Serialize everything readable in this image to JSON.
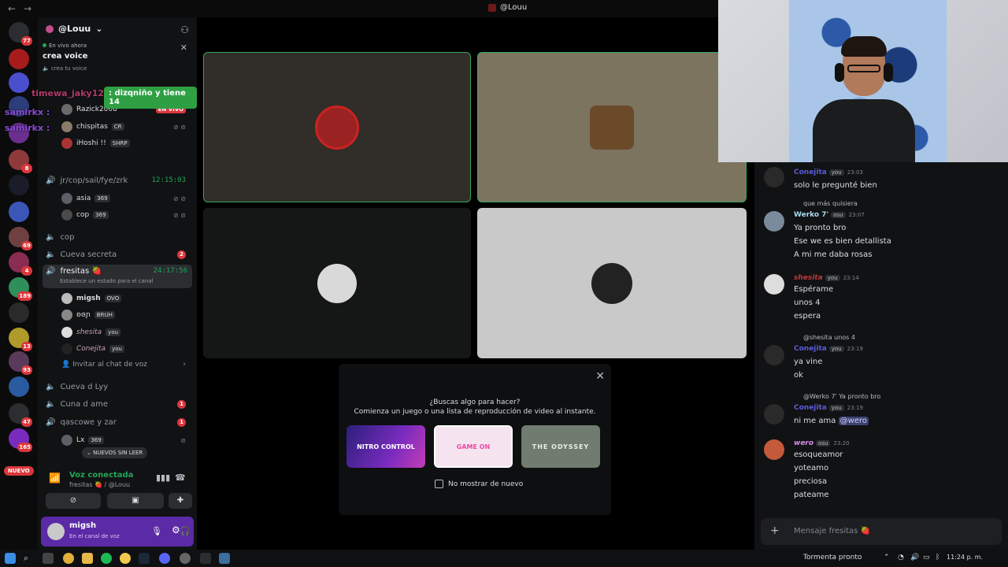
{
  "window": {
    "title": "@Louu",
    "back_label": "←",
    "forward_label": "→"
  },
  "guilds": {
    "badges": [
      "77",
      "8",
      "69",
      "4",
      "189",
      "13",
      "93",
      "47",
      "165"
    ],
    "new_label": "NUEVO"
  },
  "sidebar": {
    "server_name": "@Louu",
    "live": {
      "label": "En vivo ahora",
      "title": "crea voice",
      "subtitle": "crea tu voice"
    },
    "channels": [
      {
        "name": "jr/cop/sail/fye/zrk",
        "time": "12:15:03"
      },
      {
        "name": "cop"
      },
      {
        "name": "Cueva secreta",
        "badge": "2"
      },
      {
        "name": "fresitas 🍓",
        "time": "24:17:56",
        "status": "Establece un estado para el canal"
      },
      {
        "name": "Cueva d Lyy"
      },
      {
        "name": "Cuna d ame",
        "badge": "1"
      },
      {
        "name": "qascowe y zar",
        "badge": "1"
      }
    ],
    "members_top": [
      {
        "name": "Razick2008",
        "tag": "EN VIVO"
      },
      {
        "name": "chispitas",
        "tag": "CR"
      },
      {
        "name": "iHoshi !!",
        "tag": "SHRP"
      }
    ],
    "members_jr": [
      {
        "name": "asia",
        "tag": "369"
      },
      {
        "name": "cop",
        "tag": "369"
      }
    ],
    "members_fresitas": [
      {
        "name": "migsh",
        "tag": "OVO"
      },
      {
        "name": "ʚɞɲ",
        "tag": "BRUH"
      },
      {
        "name": "shesita",
        "tag": "you"
      },
      {
        "name": "Conejita",
        "tag": "you"
      }
    ],
    "members_qascowe": [
      {
        "name": "Lx",
        "tag": "369"
      }
    ],
    "invite_label": "Invitar al chat de voz",
    "new_unread_label": "NUEVOS SIN LEER"
  },
  "voice": {
    "title": "Voz conectada",
    "subtitle": "fresitas 🍓 / @Louu"
  },
  "user": {
    "name": "migsh",
    "status": "En el canal de voz"
  },
  "overlay": {
    "name1": "timewa_jaky123",
    "message": ": dizqniño y tiene 14",
    "name2": "samirkx :",
    "name3": "samirkx :"
  },
  "activity": {
    "question": "¿Buscas algo para hacer?",
    "subtitle": "Comienza un juego o una lista de reproducción de video al instante.",
    "cards": [
      "NITRO CONTROL",
      "GAME ON",
      "THE ODYSSEY"
    ],
    "checkbox_label": "No mostrar de nuevo",
    "close": "✕"
  },
  "chat": {
    "messages": [
      {
        "author": "Conejita",
        "tag": "you",
        "time": "23:03",
        "lines": [
          "solo le pregunté bien"
        ]
      },
      {
        "reply": "que más quisiera",
        "author": "Werko 7'",
        "tag": "osu",
        "time": "23:07",
        "lines": [
          "Ya pronto bro",
          "Ese we es bien detallista",
          "A mi me daba rosas"
        ]
      },
      {
        "author": "shesita",
        "tag": "you",
        "time": "23:14",
        "lines": [
          "Espérame",
          "unos 4",
          "espera"
        ]
      },
      {
        "reply": "@shesita  unos 4",
        "author": "Conejita",
        "tag": "you",
        "time": "23:19",
        "lines": [
          "ya vine",
          "ok"
        ]
      },
      {
        "reply": "@Werko 7'  Ya pronto bro",
        "author": "Conejita",
        "tag": "you",
        "time": "23:19",
        "lines": [
          "ni me ama",
          "@wero"
        ]
      },
      {
        "author": "wero",
        "tag": "osu",
        "time": "23:20",
        "lines": [
          "esoqueamor",
          "yoteamo",
          "preciosa",
          "pateame"
        ]
      }
    ],
    "input_placeholder": "Mensaje fresitas 🍓"
  },
  "taskbar": {
    "weather": "Tormenta pronto",
    "clock": "11:24 p. m."
  }
}
